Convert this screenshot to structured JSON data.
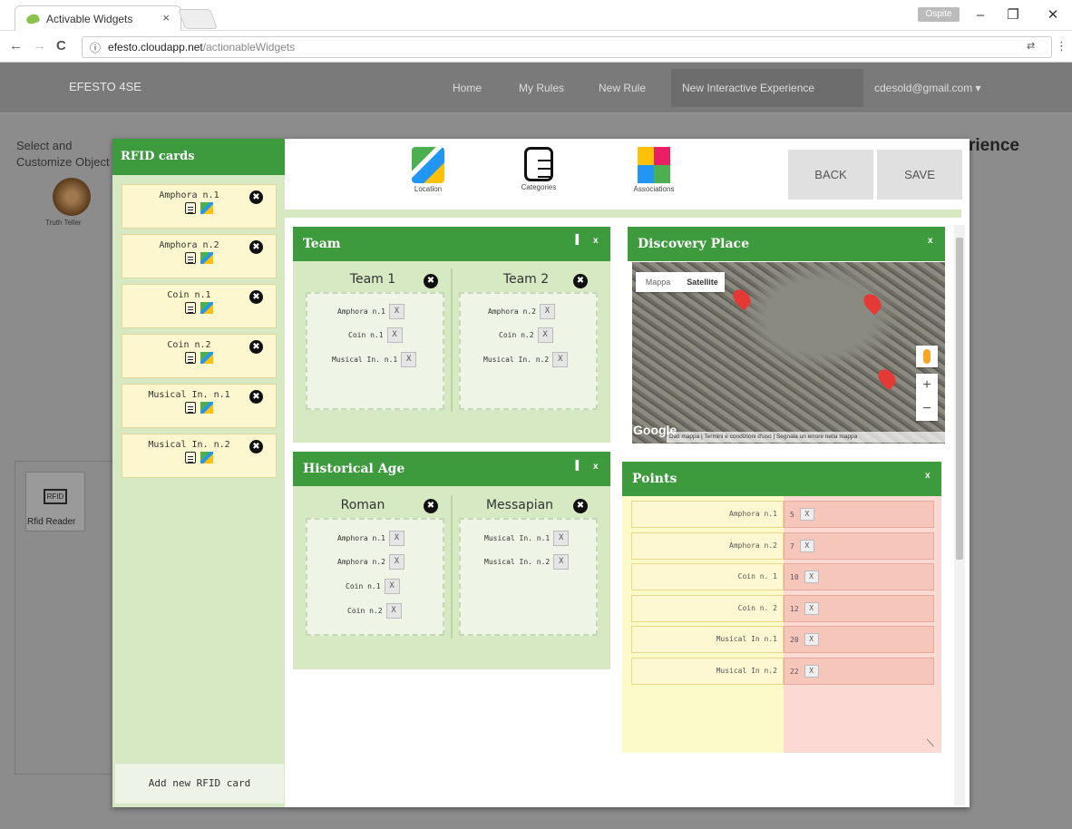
{
  "browser": {
    "tab_title": "Activable Widgets",
    "tab_close": "×",
    "url_host": "efesto.cloudapp.net",
    "url_path": "/actionableWidgets",
    "os_pill": "Ospite",
    "win_min": "–",
    "win_max": "❐",
    "win_close": "✕",
    "back": "←",
    "forward": "→",
    "reload": "C",
    "info": "ⓘ"
  },
  "site": {
    "brand": "EFESTO 4SE",
    "nav": [
      "Home",
      "My Rules",
      "New Rule",
      "New Interactive Experience"
    ],
    "user": "cdesold@gmail.com ▾"
  },
  "left": {
    "title": "Select and Customize Object",
    "object_label": "Truth Teller",
    "reader_label": "Rfid Reader",
    "reader_glyph": "RFID"
  },
  "right_title": "rience",
  "sidebar": {
    "title": "RFID cards",
    "cards": [
      "Amphora n.1",
      "Amphora n.2",
      "Coin n.1",
      "Coin n.2",
      "Musical In. n.1",
      "Musical In. n.2"
    ],
    "add": "Add new RFID card"
  },
  "toolbar": {
    "location": "Location",
    "categories": "Categories",
    "associations": "Associations",
    "back": "BACK",
    "save": "SAVE"
  },
  "team": {
    "title": "Team",
    "cols": [
      {
        "name": "Team 1",
        "items": [
          "Amphora n.1",
          "Coin n.1",
          "Musical In. n.1"
        ]
      },
      {
        "name": "Team 2",
        "items": [
          "Amphora n.2",
          "Coin n.2",
          "Musical In. n.2"
        ]
      }
    ]
  },
  "history": {
    "title": "Historical Age",
    "cols": [
      {
        "name": "Roman",
        "items": [
          "Amphora n.1",
          "Amphora n.2",
          "Coin n.1",
          "Coin n.2"
        ]
      },
      {
        "name": "Messapian",
        "items": [
          "Musical In. n.1",
          "Musical In. n.2"
        ]
      }
    ]
  },
  "discovery": {
    "title": "Discovery Place",
    "map_type": [
      "Mappa",
      "Satellite"
    ],
    "logo": "Google",
    "footer": "Dati mappa | Termini e condizioni d'uso | Segnala un errore nella mappa",
    "zoom_in": "+",
    "zoom_out": "−"
  },
  "points": {
    "title": "Points",
    "rows": [
      {
        "label": "Amphora n.1",
        "value": "5"
      },
      {
        "label": "Amphora n.2",
        "value": "7"
      },
      {
        "label": "Coin n. 1",
        "value": "10"
      },
      {
        "label": "Coin n. 2",
        "value": "12"
      },
      {
        "label": "Musical In n.1",
        "value": "20"
      },
      {
        "label": "Musical In n.2",
        "value": "22"
      }
    ]
  },
  "x": "X",
  "close_x": "x",
  "remove": "✖",
  "collapse": "▐"
}
